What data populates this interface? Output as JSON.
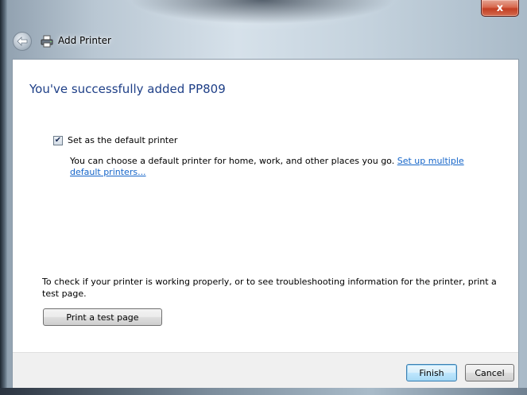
{
  "window": {
    "title": "Add Printer",
    "close_label": "x"
  },
  "main": {
    "heading": "You've successfully added PP809",
    "default_checkbox": {
      "label": "Set as the default printer",
      "checked": true
    },
    "default_description": "You can choose a default printer for home, work, and other places you go.",
    "default_link": "Set up multiple default printers...",
    "test_info": "To check if your printer is working properly, or to see troubleshooting information for the printer, print a test page.",
    "test_button": "Print a test page"
  },
  "footer": {
    "finish_label": "Finish",
    "cancel_label": "Cancel"
  },
  "icons": {
    "back": "back-arrow-icon",
    "printer": "printer-icon",
    "checkmark": "checkmark-icon"
  },
  "colors": {
    "heading": "#1e3f87",
    "link": "#1565c9",
    "close_button": "#c23e22",
    "footer_bg": "#f0f0f0"
  }
}
